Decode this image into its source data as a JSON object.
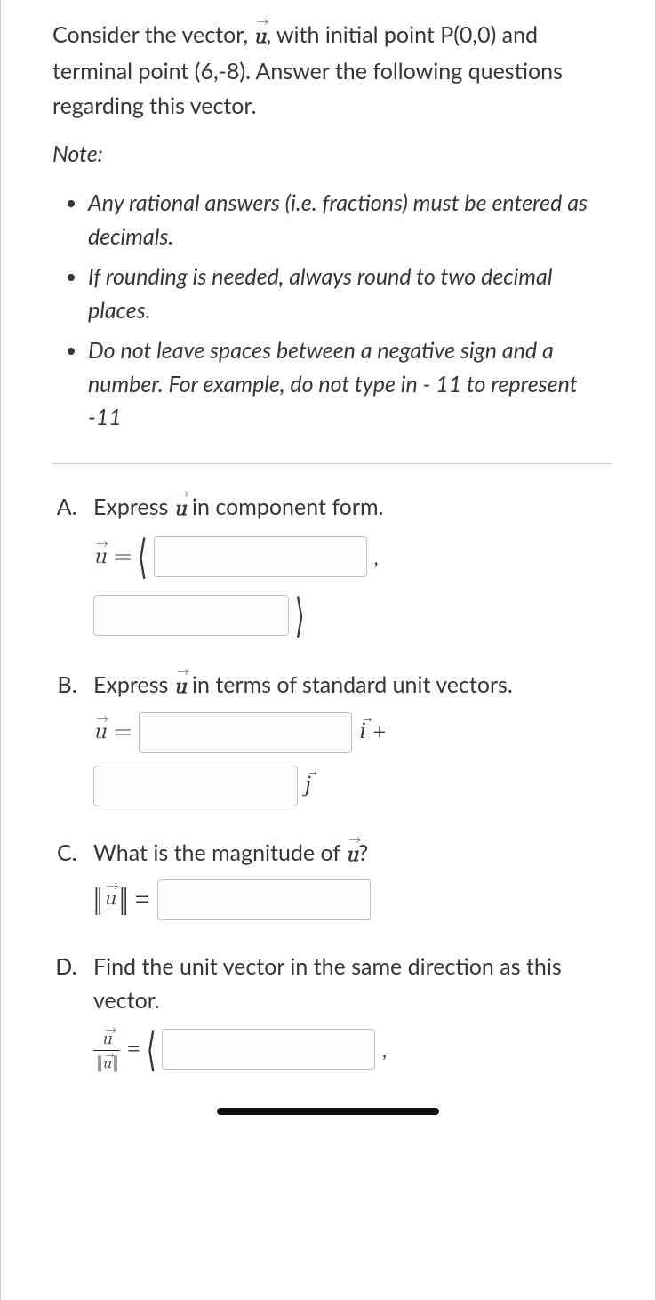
{
  "prompt": {
    "line1": "Consider the vector, u⃗, with initial point P(0,0) and terminal point (6,-8). Answer the following questions regarding this vector."
  },
  "note_label": "Note:",
  "notes": [
    "Any rational answers (i.e. fractions) must be entered as decimals.",
    "If rounding is needed, always round to two decimal places.",
    "Do not leave spaces between a negative sign and a number. For example, do not type in - 11 to represent -11"
  ],
  "questions": {
    "A": {
      "text": "Express u⃗ in component form.",
      "prefix": "u⃗ ="
    },
    "B": {
      "text": "Express u⃗ in terms of standard unit vectors.",
      "prefix": "u⃗ =",
      "i_label": "i⃗",
      "plus": "+",
      "j_label": "j⃗"
    },
    "C": {
      "text": "What is the magnitude of u⃗?",
      "prefix": "||u⃗|| ="
    },
    "D": {
      "text": "Find the unit vector in the same direction as this vector.",
      "prefix": "u⃗ / ||u⃗|| ="
    }
  },
  "glyphs": {
    "langle": "⟨",
    "rangle": "⟩",
    "comma": ","
  }
}
